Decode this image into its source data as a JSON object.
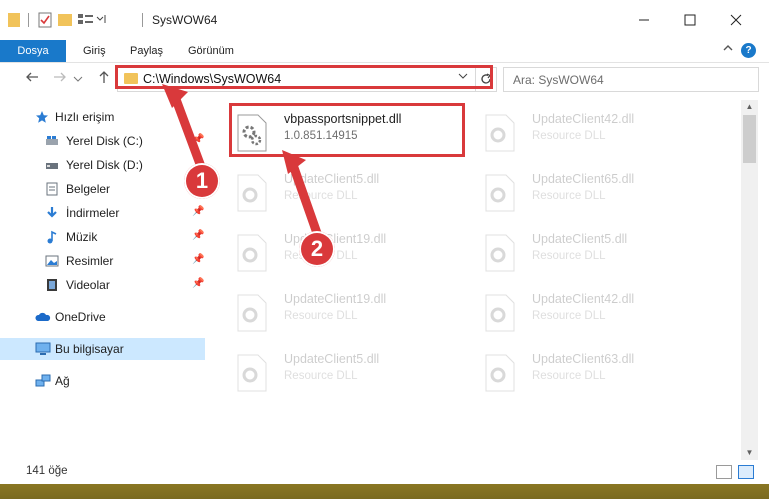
{
  "window": {
    "title": "SysWOW64"
  },
  "ribbon": {
    "tabs": [
      "Dosya",
      "Giriş",
      "Paylaş",
      "Görünüm"
    ],
    "help": "?"
  },
  "nav": {
    "address": "C:\\Windows\\SysWOW64",
    "search_placeholder": "Ara: SysWOW64"
  },
  "sidebar": {
    "items": [
      {
        "label": "Hızlı erişim",
        "icon": "star-icon"
      },
      {
        "label": "Yerel Disk (C:)",
        "icon": "drive-icon"
      },
      {
        "label": "Yerel Disk (D:)",
        "icon": "drive-icon"
      },
      {
        "label": "Belgeler",
        "icon": "documents-icon"
      },
      {
        "label": "İndirmeler",
        "icon": "download-icon"
      },
      {
        "label": "Müzik",
        "icon": "music-icon"
      },
      {
        "label": "Resimler",
        "icon": "pictures-icon"
      },
      {
        "label": "Videolar",
        "icon": "videos-icon"
      },
      {
        "label": "OneDrive",
        "icon": "cloud-icon"
      },
      {
        "label": "Bu bilgisayar",
        "icon": "computer-icon"
      },
      {
        "label": "Ağ",
        "icon": "network-icon"
      }
    ]
  },
  "files": {
    "focus": {
      "name": "vbpassportsnippet.dll",
      "detail": "1.0.851.14915"
    },
    "ghosts": [
      {
        "name": "UpdateClient42.dll",
        "detail": "Resource DLL"
      },
      {
        "name": "UpdateClient5.dll",
        "detail": "Resource DLL"
      },
      {
        "name": "UpdateClient65.dll",
        "detail": "Resource DLL"
      },
      {
        "name": "UpdateClient19.dll",
        "detail": "Resource DLL"
      },
      {
        "name": "UpdateClient5.dll",
        "detail": "Resource DLL"
      },
      {
        "name": "UpdateClient19.dll",
        "detail": "Resource DLL"
      },
      {
        "name": "UpdateClient42.dll",
        "detail": "Resource DLL"
      },
      {
        "name": "UpdateClient5.dll",
        "detail": "Resource DLL"
      },
      {
        "name": "UpdateClient63.dll",
        "detail": "Resource DLL"
      }
    ]
  },
  "status": {
    "count": "141 öğe"
  },
  "callouts": {
    "one": "1",
    "two": "2",
    "color": "#d9393b"
  }
}
